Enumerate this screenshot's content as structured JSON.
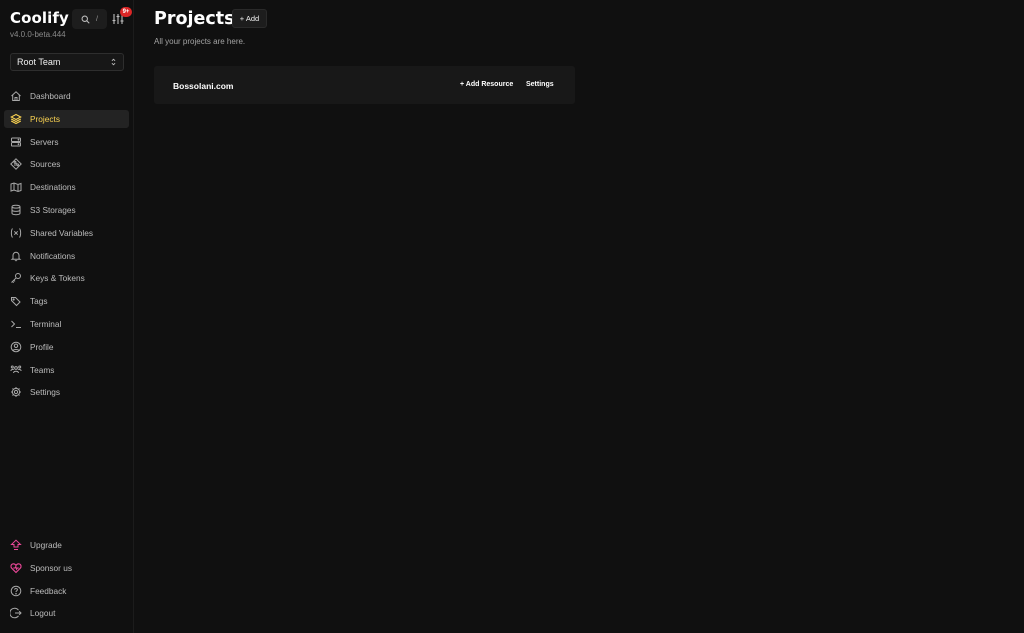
{
  "app": {
    "name": "Coolify",
    "version": "v4.0.0-beta.444",
    "search_shortcut": "/",
    "notification_badge": "9+"
  },
  "team_selector": {
    "selected": "Root Team"
  },
  "nav": {
    "items": [
      {
        "label": "Dashboard",
        "icon": "home-icon",
        "active": false
      },
      {
        "label": "Projects",
        "icon": "layers-icon",
        "active": true
      },
      {
        "label": "Servers",
        "icon": "server-icon",
        "active": false
      },
      {
        "label": "Sources",
        "icon": "git-branch-icon",
        "active": false
      },
      {
        "label": "Destinations",
        "icon": "map-icon",
        "active": false
      },
      {
        "label": "S3 Storages",
        "icon": "database-icon",
        "active": false
      },
      {
        "label": "Shared Variables",
        "icon": "variable-icon",
        "active": false
      },
      {
        "label": "Notifications",
        "icon": "bell-icon",
        "active": false
      },
      {
        "label": "Keys & Tokens",
        "icon": "key-icon",
        "active": false
      },
      {
        "label": "Tags",
        "icon": "tag-icon",
        "active": false
      },
      {
        "label": "Terminal",
        "icon": "terminal-icon",
        "active": false
      },
      {
        "label": "Profile",
        "icon": "user-circle-icon",
        "active": false
      },
      {
        "label": "Teams",
        "icon": "users-icon",
        "active": false
      },
      {
        "label": "Settings",
        "icon": "gear-icon",
        "active": false
      }
    ],
    "bottom_items": [
      {
        "label": "Upgrade",
        "icon": "upgrade-icon"
      },
      {
        "label": "Sponsor us",
        "icon": "heart-icon"
      },
      {
        "label": "Feedback",
        "icon": "help-circle-icon"
      },
      {
        "label": "Logout",
        "icon": "logout-icon"
      }
    ]
  },
  "page": {
    "title": "Projects",
    "add_label": "+ Add",
    "subtitle": "All your projects are here."
  },
  "projects": [
    {
      "name": "Bossolani.com",
      "add_resource_label": "+ Add Resource",
      "settings_label": "Settings"
    }
  ],
  "colors": {
    "background": "#101010",
    "active_nav": "#fcd452",
    "badge": "#dc2626",
    "sponsor_accent": "#ec4899"
  }
}
